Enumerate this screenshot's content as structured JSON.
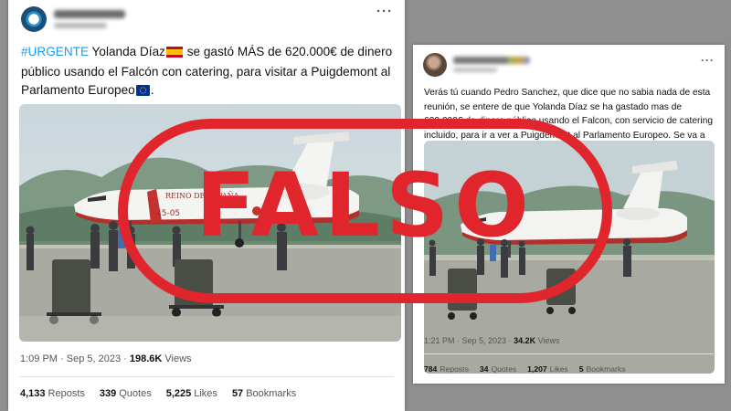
{
  "left_tweet": {
    "hashtag": "#URGENTE",
    "text_part1": " Yolanda Díaz",
    "text_part2": " se gastó MÁS de 620.000€ de dinero público usando el Falcón con catering, para visitar a Puigdemont al Parlamento Europeo",
    "timestamp": "1:09 PM · Sep 5, 2023 · ",
    "views_value": "198.6K",
    "views_label": " Views",
    "reposts_value": "4,133",
    "reposts_label": "Reposts",
    "quotes_value": "339",
    "quotes_label": "Quotes",
    "likes_value": "5,225",
    "likes_label": "Likes",
    "bookmarks_value": "57",
    "bookmarks_label": "Bookmarks"
  },
  "right_tweet": {
    "text": "Verás tú cuando Pedro Sanchez, que dice que no sabia nada de esta reunión, se entere de que Yolanda Díaz se ha gastado mas de 620.000€ de dinero público usando el Falcon, con servicio de catering incluido, para ir a ver a Puigdemont al Parlamento Europeo. Se va a liar parda.",
    "timestamp": "1:21 PM · Sep 5, 2023 · ",
    "views_value": "34.2K",
    "views_label": " Views",
    "reposts_value": "784",
    "reposts_label": "Reposts",
    "quotes_value": "34",
    "quotes_label": "Quotes",
    "likes_value": "1,207",
    "likes_label": "Likes",
    "bookmarks_value": "5",
    "bookmarks_label": "Bookmarks"
  },
  "stamp": {
    "label": "FALSO",
    "color": "#e0262c"
  },
  "photo": {
    "aircraft_title": "REINO DE ESPAÑA",
    "registration": "45-05"
  },
  "icons": {
    "menu": "more-options-icon",
    "spain_flag": "spain-flag-icon",
    "eu_flag": "eu-flag-icon"
  }
}
